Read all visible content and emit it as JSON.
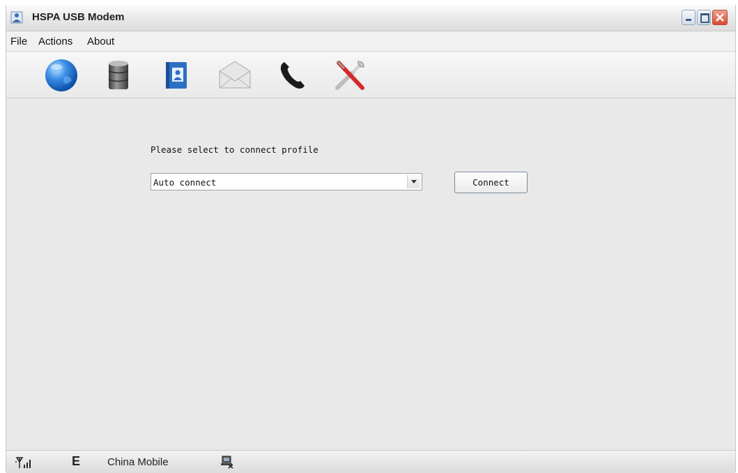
{
  "window": {
    "title": "HSPA USB Modem",
    "buttons": {
      "minimize": "minimize",
      "maximize": "maximize",
      "close": "close"
    }
  },
  "menu": {
    "items": [
      "File",
      "Actions",
      "About"
    ]
  },
  "toolbar": {
    "icons": [
      "globe-icon",
      "database-icon",
      "contacts-icon",
      "envelope-icon",
      "phone-icon",
      "tools-icon"
    ]
  },
  "connection": {
    "prompt": "Please select to connect profile",
    "profile_selected": "Auto connect",
    "connect_label": "Connect"
  },
  "status": {
    "network_type": "E",
    "operator": "China Mobile",
    "icons": [
      "signal-strength-icon",
      "network-status-icon"
    ]
  },
  "colors": {
    "window_bg": "#e9e9e9",
    "close_button": "#d84a2f",
    "globe_blue": "#1e74d6"
  }
}
